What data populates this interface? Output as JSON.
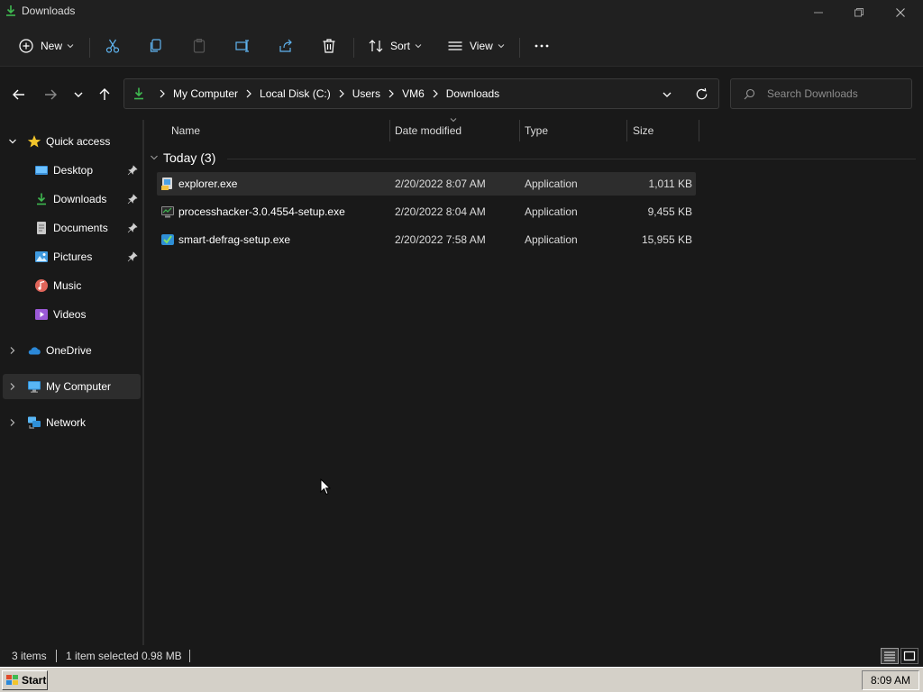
{
  "window": {
    "title": "Downloads",
    "controls": [
      "minimize-icon",
      "restore-icon",
      "close-icon"
    ]
  },
  "command_bar": {
    "new_label": "New",
    "sort_label": "Sort",
    "view_label": "View",
    "icons": [
      "cut-icon",
      "copy-icon",
      "paste-icon",
      "rename-icon",
      "share-icon",
      "delete-icon",
      "more-icon"
    ]
  },
  "address_bar": {
    "breadcrumbs": [
      "My Computer",
      "Local Disk (C:)",
      "Users",
      "VM6",
      "Downloads"
    ]
  },
  "search": {
    "placeholder": "Search Downloads"
  },
  "sidebar": {
    "quick_access": "Quick access",
    "items": [
      {
        "label": "Desktop",
        "pinned": true
      },
      {
        "label": "Downloads",
        "pinned": true
      },
      {
        "label": "Documents",
        "pinned": true
      },
      {
        "label": "Pictures",
        "pinned": true
      },
      {
        "label": "Music",
        "pinned": false
      },
      {
        "label": "Videos",
        "pinned": false
      }
    ],
    "onedrive": "OneDrive",
    "my_computer": "My Computer",
    "network": "Network"
  },
  "columns": {
    "name": "Name",
    "date_modified": "Date modified",
    "type": "Type",
    "size": "Size"
  },
  "group": {
    "label": "Today (3)"
  },
  "files": [
    {
      "name": "explorer.exe",
      "date": "2/20/2022 8:07 AM",
      "type": "Application",
      "size": "1,011 KB",
      "selected": true
    },
    {
      "name": "processhacker-3.0.4554-setup.exe",
      "date": "2/20/2022 8:04 AM",
      "type": "Application",
      "size": "9,455 KB",
      "selected": false
    },
    {
      "name": "smart-defrag-setup.exe",
      "date": "2/20/2022 7:58 AM",
      "type": "Application",
      "size": "15,955 KB",
      "selected": false
    }
  ],
  "status": {
    "items": "3 items",
    "selected": "1 item selected",
    "selected_size": "0.98 MB"
  },
  "taskbar": {
    "start_label": "Start",
    "clock": "8:09 AM"
  },
  "colors": {
    "background": "#191919",
    "chrome": "#202020",
    "selection": "#2d2d2d",
    "accent_green": "#2ea043",
    "accent_blue": "#4aa0e6"
  }
}
